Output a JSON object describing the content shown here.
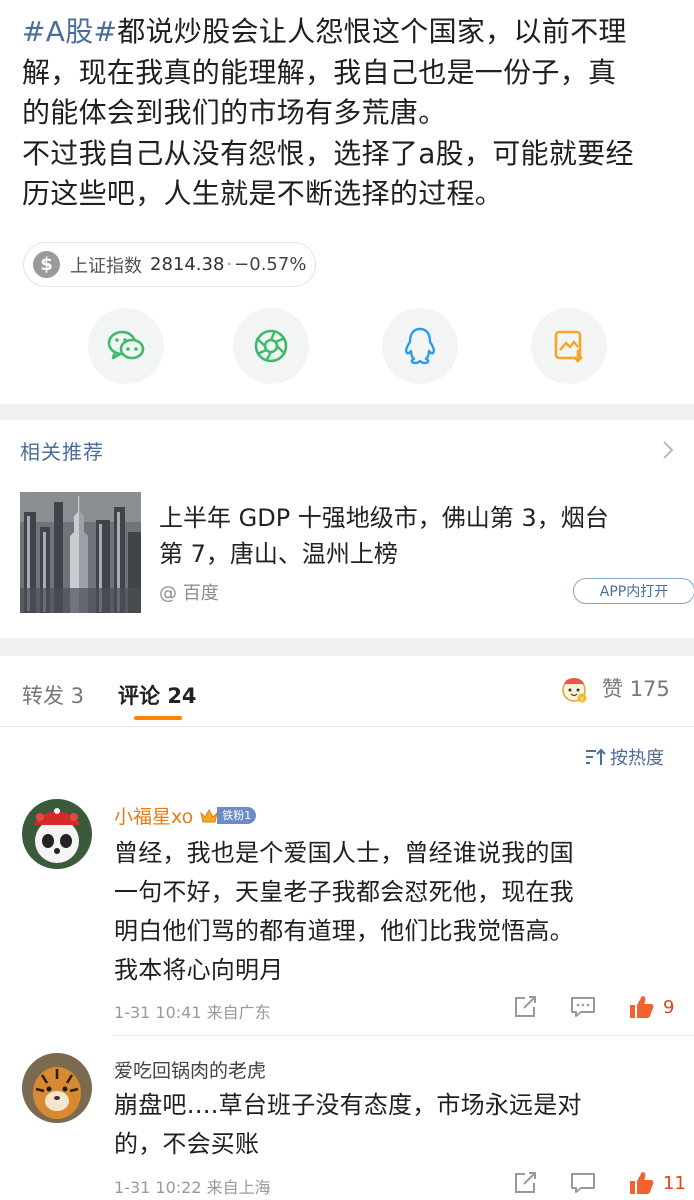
{
  "post": {
    "hashtag": "#A股#",
    "line1": "都说炒股会让人怨恨这个国家，以前不理",
    "line2": "解，现在我真的能理解，我自己也是一份子，真",
    "line3": "的能体会到我们的市场有多荒唐。",
    "line4": "不过我自己从没有怨恨，选择了a股，可能就要经",
    "line5": "历这些吧，人生就是不断选择的过程。"
  },
  "stock": {
    "icon": "dollar-coin-icon",
    "name": "上证指数",
    "value": "2814.38",
    "separator": "·",
    "change": "−0.57%"
  },
  "share": {
    "buttons": [
      "wechat-icon",
      "moments-icon",
      "qq-icon",
      "save-image-icon"
    ],
    "colors": {
      "wechat": "#3dbb6b",
      "moments": "#3dbb6b",
      "qq": "#2e9be8",
      "save": "#f4a52a"
    }
  },
  "related": {
    "title": "相关推荐",
    "article_title_line1": "上半年 GDP 十强地级市，佛山第 3，烟台",
    "article_title_line2": "第 7，唐山、温州上榜",
    "source": "@ 百度",
    "open_app": "APP内打开"
  },
  "tabs": {
    "repost": "转发 3",
    "comment_label": "评论",
    "comment_count": "24",
    "like_label": "赞",
    "like_count": "175",
    "accent": "#ff8200"
  },
  "sort": {
    "label": "按热度"
  },
  "comments": [
    {
      "user": "小福星xo",
      "badge": "铁粉1",
      "text_lines": [
        "曾经，我也是个爱国人士，曾经谁说我的国",
        "一句不好，天皇老子我都会怼死他，现在我",
        "明白他们骂的都有道理，他们比我觉悟高。",
        "我本将心向明月"
      ],
      "meta": "1-31 10:41  来自广东",
      "likes": "9"
    },
    {
      "user": "爱吃回锅肉的老虎",
      "text_lines": [
        "崩盘吧….草台班子没有态度，市场永远是对",
        "的，不会买账"
      ],
      "meta": "1-31 10:22  来自上海",
      "likes": "11"
    }
  ]
}
